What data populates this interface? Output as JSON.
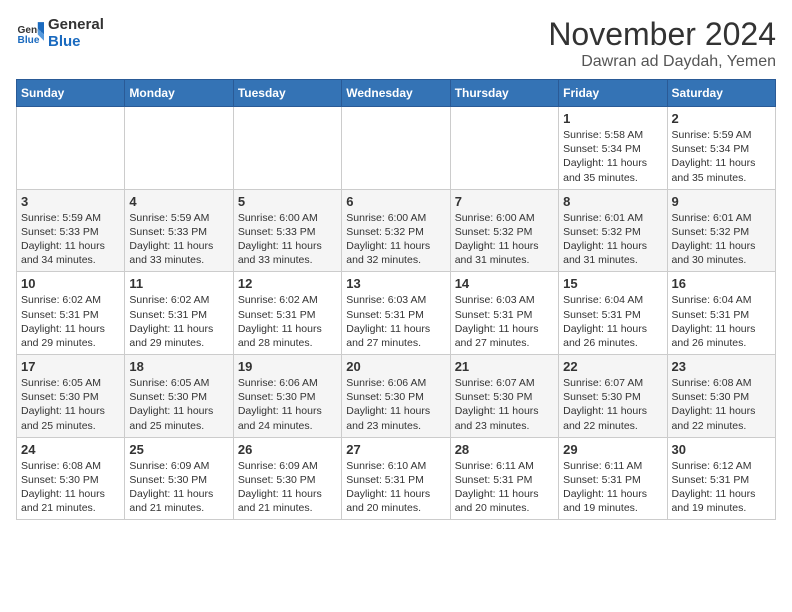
{
  "header": {
    "logo_line1": "General",
    "logo_line2": "Blue",
    "month_year": "November 2024",
    "location": "Dawran ad Daydah, Yemen"
  },
  "weekdays": [
    "Sunday",
    "Monday",
    "Tuesday",
    "Wednesday",
    "Thursday",
    "Friday",
    "Saturday"
  ],
  "weeks": [
    [
      {
        "day": "",
        "info": ""
      },
      {
        "day": "",
        "info": ""
      },
      {
        "day": "",
        "info": ""
      },
      {
        "day": "",
        "info": ""
      },
      {
        "day": "",
        "info": ""
      },
      {
        "day": "1",
        "info": "Sunrise: 5:58 AM\nSunset: 5:34 PM\nDaylight: 11 hours\nand 35 minutes."
      },
      {
        "day": "2",
        "info": "Sunrise: 5:59 AM\nSunset: 5:34 PM\nDaylight: 11 hours\nand 35 minutes."
      }
    ],
    [
      {
        "day": "3",
        "info": "Sunrise: 5:59 AM\nSunset: 5:33 PM\nDaylight: 11 hours\nand 34 minutes."
      },
      {
        "day": "4",
        "info": "Sunrise: 5:59 AM\nSunset: 5:33 PM\nDaylight: 11 hours\nand 33 minutes."
      },
      {
        "day": "5",
        "info": "Sunrise: 6:00 AM\nSunset: 5:33 PM\nDaylight: 11 hours\nand 33 minutes."
      },
      {
        "day": "6",
        "info": "Sunrise: 6:00 AM\nSunset: 5:32 PM\nDaylight: 11 hours\nand 32 minutes."
      },
      {
        "day": "7",
        "info": "Sunrise: 6:00 AM\nSunset: 5:32 PM\nDaylight: 11 hours\nand 31 minutes."
      },
      {
        "day": "8",
        "info": "Sunrise: 6:01 AM\nSunset: 5:32 PM\nDaylight: 11 hours\nand 31 minutes."
      },
      {
        "day": "9",
        "info": "Sunrise: 6:01 AM\nSunset: 5:32 PM\nDaylight: 11 hours\nand 30 minutes."
      }
    ],
    [
      {
        "day": "10",
        "info": "Sunrise: 6:02 AM\nSunset: 5:31 PM\nDaylight: 11 hours\nand 29 minutes."
      },
      {
        "day": "11",
        "info": "Sunrise: 6:02 AM\nSunset: 5:31 PM\nDaylight: 11 hours\nand 29 minutes."
      },
      {
        "day": "12",
        "info": "Sunrise: 6:02 AM\nSunset: 5:31 PM\nDaylight: 11 hours\nand 28 minutes."
      },
      {
        "day": "13",
        "info": "Sunrise: 6:03 AM\nSunset: 5:31 PM\nDaylight: 11 hours\nand 27 minutes."
      },
      {
        "day": "14",
        "info": "Sunrise: 6:03 AM\nSunset: 5:31 PM\nDaylight: 11 hours\nand 27 minutes."
      },
      {
        "day": "15",
        "info": "Sunrise: 6:04 AM\nSunset: 5:31 PM\nDaylight: 11 hours\nand 26 minutes."
      },
      {
        "day": "16",
        "info": "Sunrise: 6:04 AM\nSunset: 5:31 PM\nDaylight: 11 hours\nand 26 minutes."
      }
    ],
    [
      {
        "day": "17",
        "info": "Sunrise: 6:05 AM\nSunset: 5:30 PM\nDaylight: 11 hours\nand 25 minutes."
      },
      {
        "day": "18",
        "info": "Sunrise: 6:05 AM\nSunset: 5:30 PM\nDaylight: 11 hours\nand 25 minutes."
      },
      {
        "day": "19",
        "info": "Sunrise: 6:06 AM\nSunset: 5:30 PM\nDaylight: 11 hours\nand 24 minutes."
      },
      {
        "day": "20",
        "info": "Sunrise: 6:06 AM\nSunset: 5:30 PM\nDaylight: 11 hours\nand 23 minutes."
      },
      {
        "day": "21",
        "info": "Sunrise: 6:07 AM\nSunset: 5:30 PM\nDaylight: 11 hours\nand 23 minutes."
      },
      {
        "day": "22",
        "info": "Sunrise: 6:07 AM\nSunset: 5:30 PM\nDaylight: 11 hours\nand 22 minutes."
      },
      {
        "day": "23",
        "info": "Sunrise: 6:08 AM\nSunset: 5:30 PM\nDaylight: 11 hours\nand 22 minutes."
      }
    ],
    [
      {
        "day": "24",
        "info": "Sunrise: 6:08 AM\nSunset: 5:30 PM\nDaylight: 11 hours\nand 21 minutes."
      },
      {
        "day": "25",
        "info": "Sunrise: 6:09 AM\nSunset: 5:30 PM\nDaylight: 11 hours\nand 21 minutes."
      },
      {
        "day": "26",
        "info": "Sunrise: 6:09 AM\nSunset: 5:30 PM\nDaylight: 11 hours\nand 21 minutes."
      },
      {
        "day": "27",
        "info": "Sunrise: 6:10 AM\nSunset: 5:31 PM\nDaylight: 11 hours\nand 20 minutes."
      },
      {
        "day": "28",
        "info": "Sunrise: 6:11 AM\nSunset: 5:31 PM\nDaylight: 11 hours\nand 20 minutes."
      },
      {
        "day": "29",
        "info": "Sunrise: 6:11 AM\nSunset: 5:31 PM\nDaylight: 11 hours\nand 19 minutes."
      },
      {
        "day": "30",
        "info": "Sunrise: 6:12 AM\nSunset: 5:31 PM\nDaylight: 11 hours\nand 19 minutes."
      }
    ]
  ]
}
